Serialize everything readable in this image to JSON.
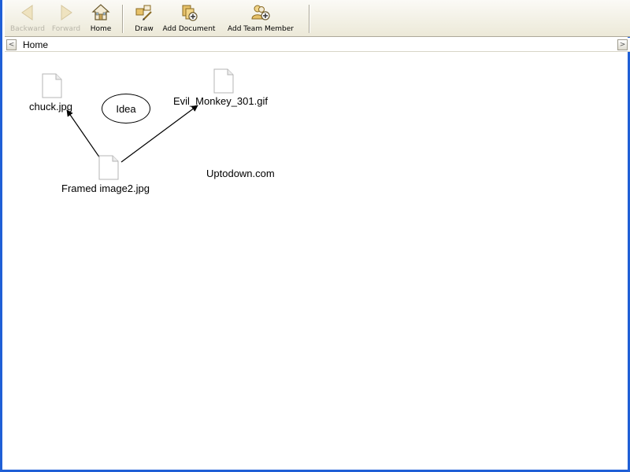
{
  "toolbar": {
    "buttons": [
      {
        "id": "backward",
        "label": "Backward",
        "icon": "back-arrow-icon",
        "enabled": false
      },
      {
        "id": "forward",
        "label": "Forward",
        "icon": "forward-arrow-icon",
        "enabled": false
      },
      {
        "id": "home",
        "label": "Home",
        "icon": "house-icon",
        "enabled": true
      },
      {
        "id": "draw",
        "label": "Draw",
        "icon": "draw-tools-icon",
        "enabled": true
      },
      {
        "id": "add_document",
        "label": "Add Document",
        "icon": "add-document-icon",
        "enabled": true
      },
      {
        "id": "add_team_member",
        "label": "Add Team Member",
        "icon": "add-team-member-icon",
        "enabled": true
      }
    ]
  },
  "breadcrumb": {
    "current": "Home",
    "left_arrow": "<",
    "right_arrow": ">"
  },
  "canvas": {
    "nodes": [
      {
        "id": "chuck",
        "type": "document",
        "label": "chuck.jpg"
      },
      {
        "id": "evil_monkey",
        "type": "document",
        "label": "Evil_Monkey_301.gif"
      },
      {
        "id": "framed_image2",
        "type": "document",
        "label": "Framed image2.jpg"
      },
      {
        "id": "idea",
        "type": "idea",
        "label": "Idea"
      },
      {
        "id": "uptodown",
        "type": "text",
        "label": "Uptodown.com"
      }
    ],
    "links": [
      {
        "from": "framed_image2",
        "to": "chuck"
      },
      {
        "from": "framed_image2",
        "to": "evil_monkey"
      }
    ]
  },
  "colors": {
    "window_border": "#1f5fd6",
    "toolbar_top": "#fbfaf6",
    "toolbar_bottom": "#ece9d8",
    "disabled_text": "#b9b6aa",
    "icon_gold": "#d9a441"
  }
}
